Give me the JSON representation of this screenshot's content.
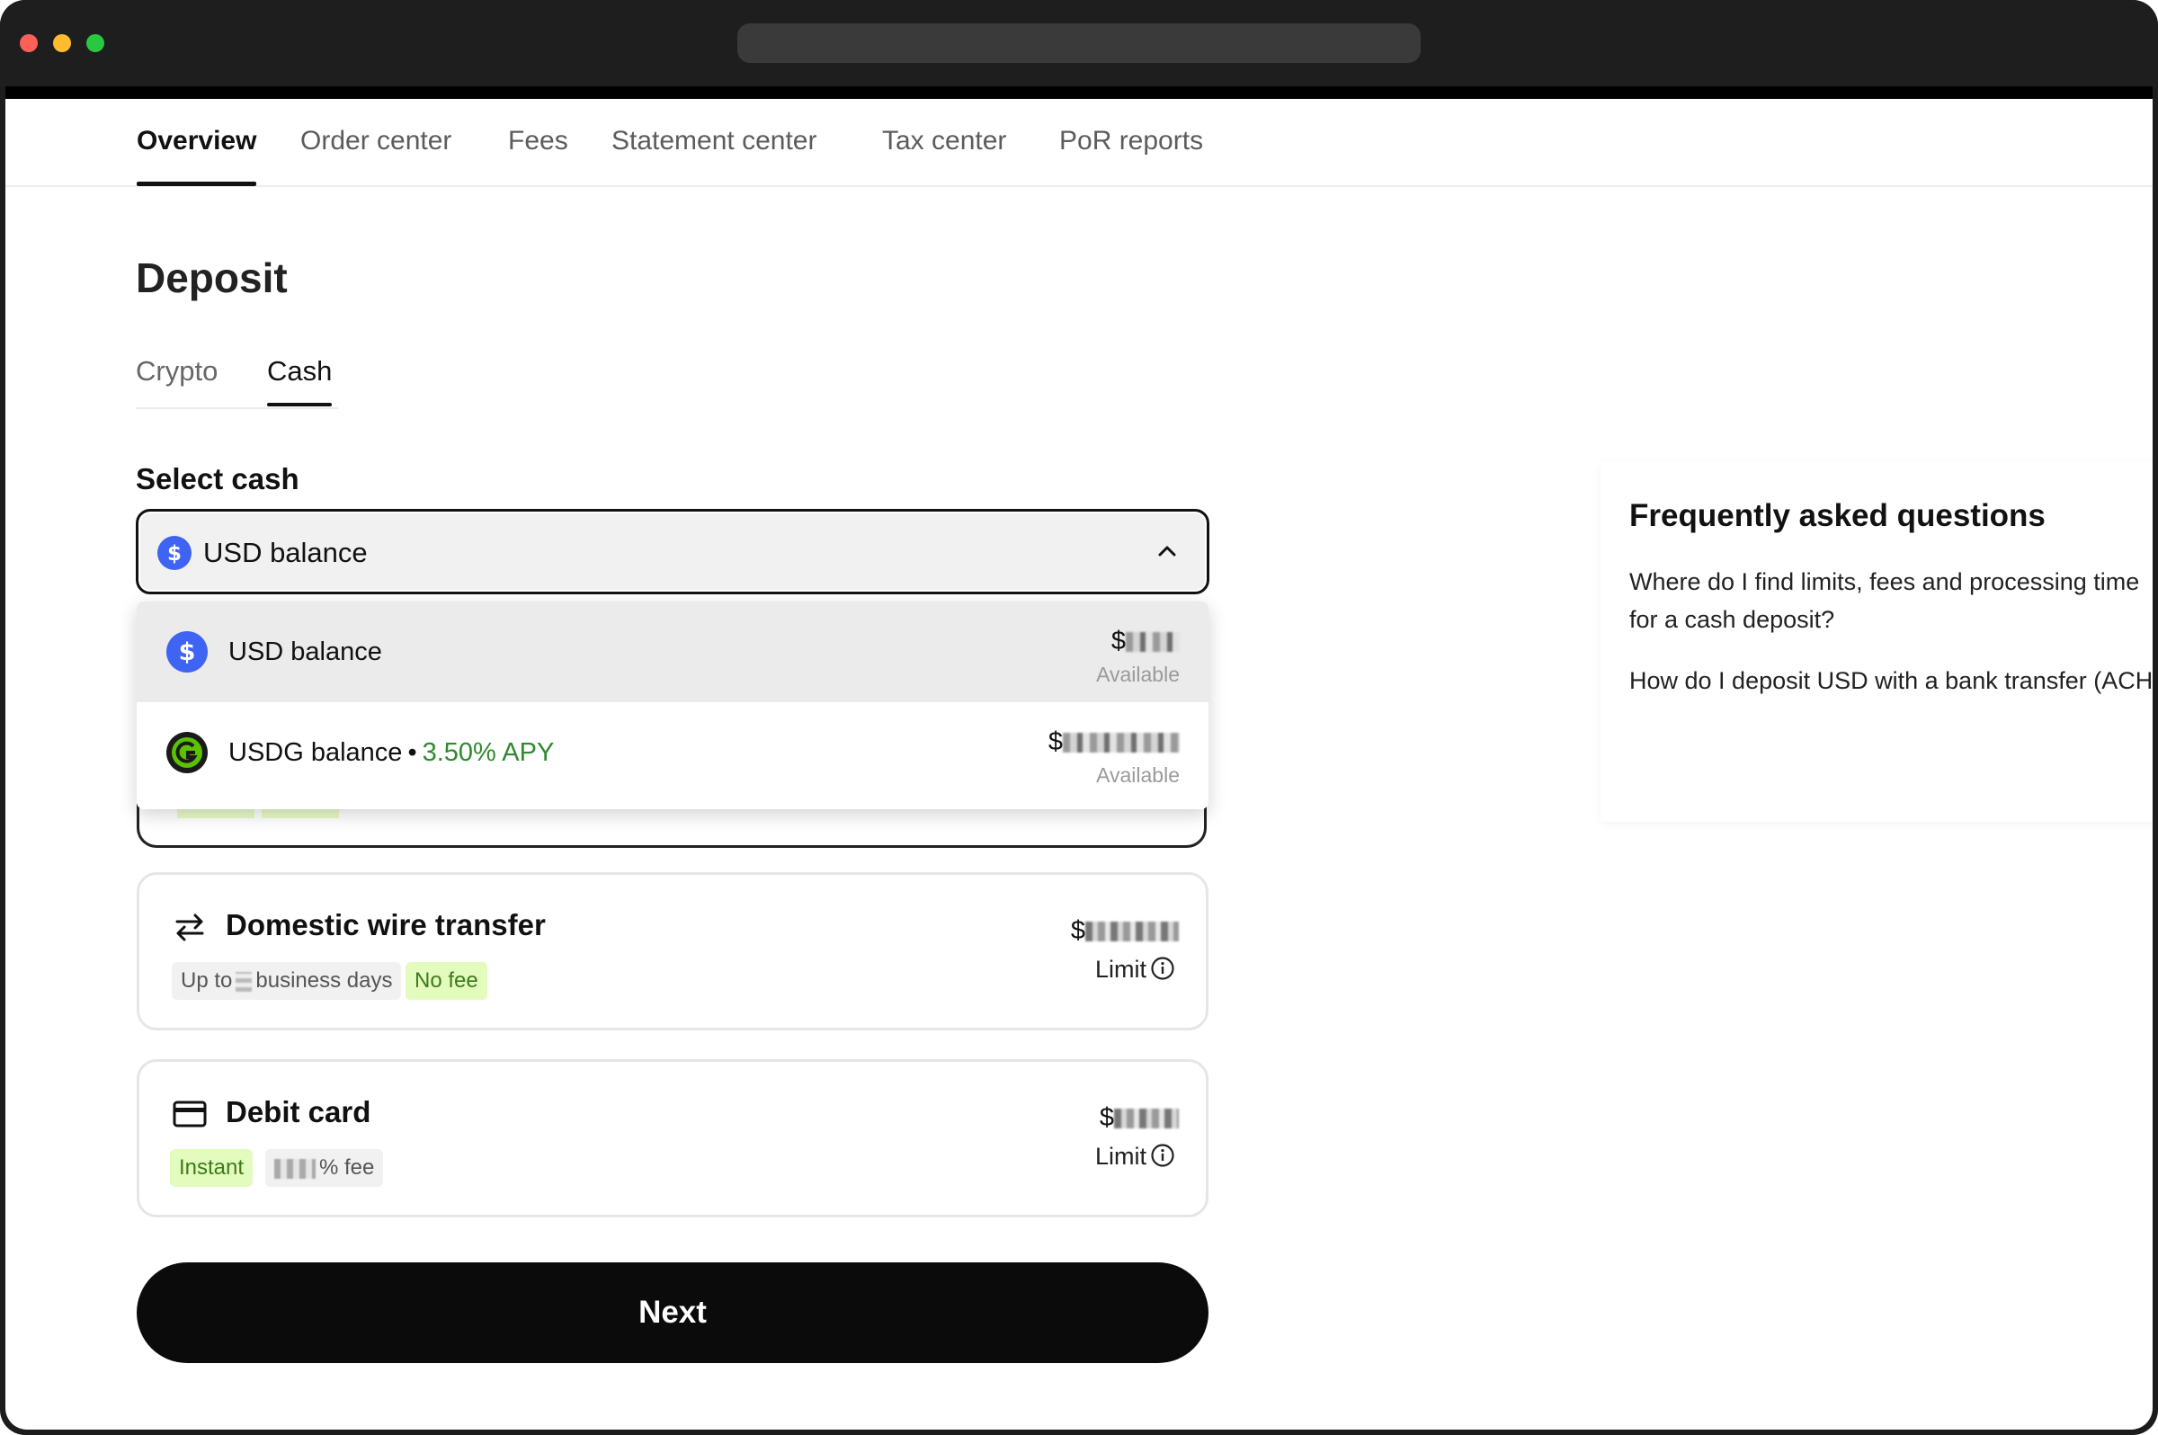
{
  "nav": {
    "tabs": [
      {
        "label": "Overview"
      },
      {
        "label": "Order center"
      },
      {
        "label": "Fees"
      },
      {
        "label": "Statement center"
      },
      {
        "label": "Tax center"
      },
      {
        "label": "PoR reports"
      }
    ]
  },
  "page": {
    "title": "Deposit",
    "subtabs": [
      {
        "label": "Crypto"
      },
      {
        "label": "Cash"
      }
    ],
    "select_label": "Select cash",
    "selected_value": "USD balance"
  },
  "dropdown": {
    "options": [
      {
        "label": "USD balance",
        "amount_prefix": "$",
        "available": "Available"
      },
      {
        "label": "USDG balance",
        "separator": "•",
        "apy": "3.50% APY",
        "amount_prefix": "$",
        "available": "Available"
      }
    ]
  },
  "methods": {
    "wire": {
      "title": "Domestic wire transfer",
      "tag_time_prefix": "Up to",
      "tag_time_suffix": "business days",
      "tag_fee": "No fee",
      "amount_prefix": "$",
      "limit": "Limit"
    },
    "debit": {
      "title": "Debit card",
      "tag_speed": "Instant",
      "tag_fee_suffix": "% fee",
      "amount_prefix": "$",
      "limit": "Limit"
    }
  },
  "next_label": "Next",
  "faq": {
    "title": "Frequently asked questions",
    "questions": [
      "Where do I find limits, fees and processing time for a cash deposit?",
      "How do I deposit USD with a bank transfer (ACH"
    ]
  },
  "colors": {
    "usd_icon": "#3f63f2",
    "usdg_icon": "#5cc200",
    "apy_text": "#2f8a2f",
    "tag_green_bg": "#e3fbbd"
  },
  "icons": {
    "usd": "dollar-coin-icon",
    "usdg": "usdg-coin-icon",
    "wire": "transfer-arrows-icon",
    "debit": "credit-card-icon",
    "chevron": "chevron-up-icon",
    "info": "info-icon"
  }
}
